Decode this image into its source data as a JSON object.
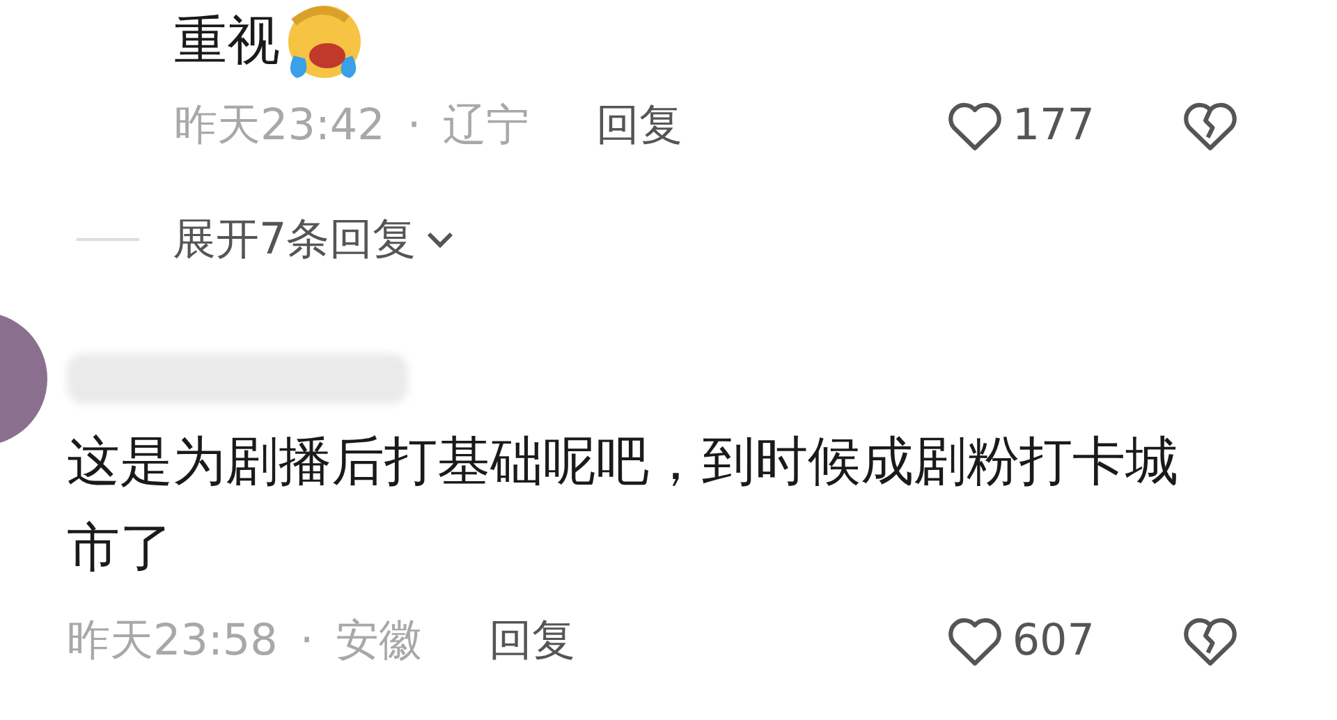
{
  "reply_comment": {
    "text": "重视",
    "time": "昨天23:42",
    "separator": "·",
    "location": "辽宁",
    "reply_label": "回复",
    "likes": "177"
  },
  "expand_replies": {
    "label": "展开7条回复",
    "expanded": false
  },
  "comment": {
    "text": "这是为剧播后打基础呢吧，到时候成剧粉打卡城市了",
    "time": "昨天23:58",
    "separator": "·",
    "location": "安徽",
    "reply_label": "回复",
    "likes": "607"
  }
}
